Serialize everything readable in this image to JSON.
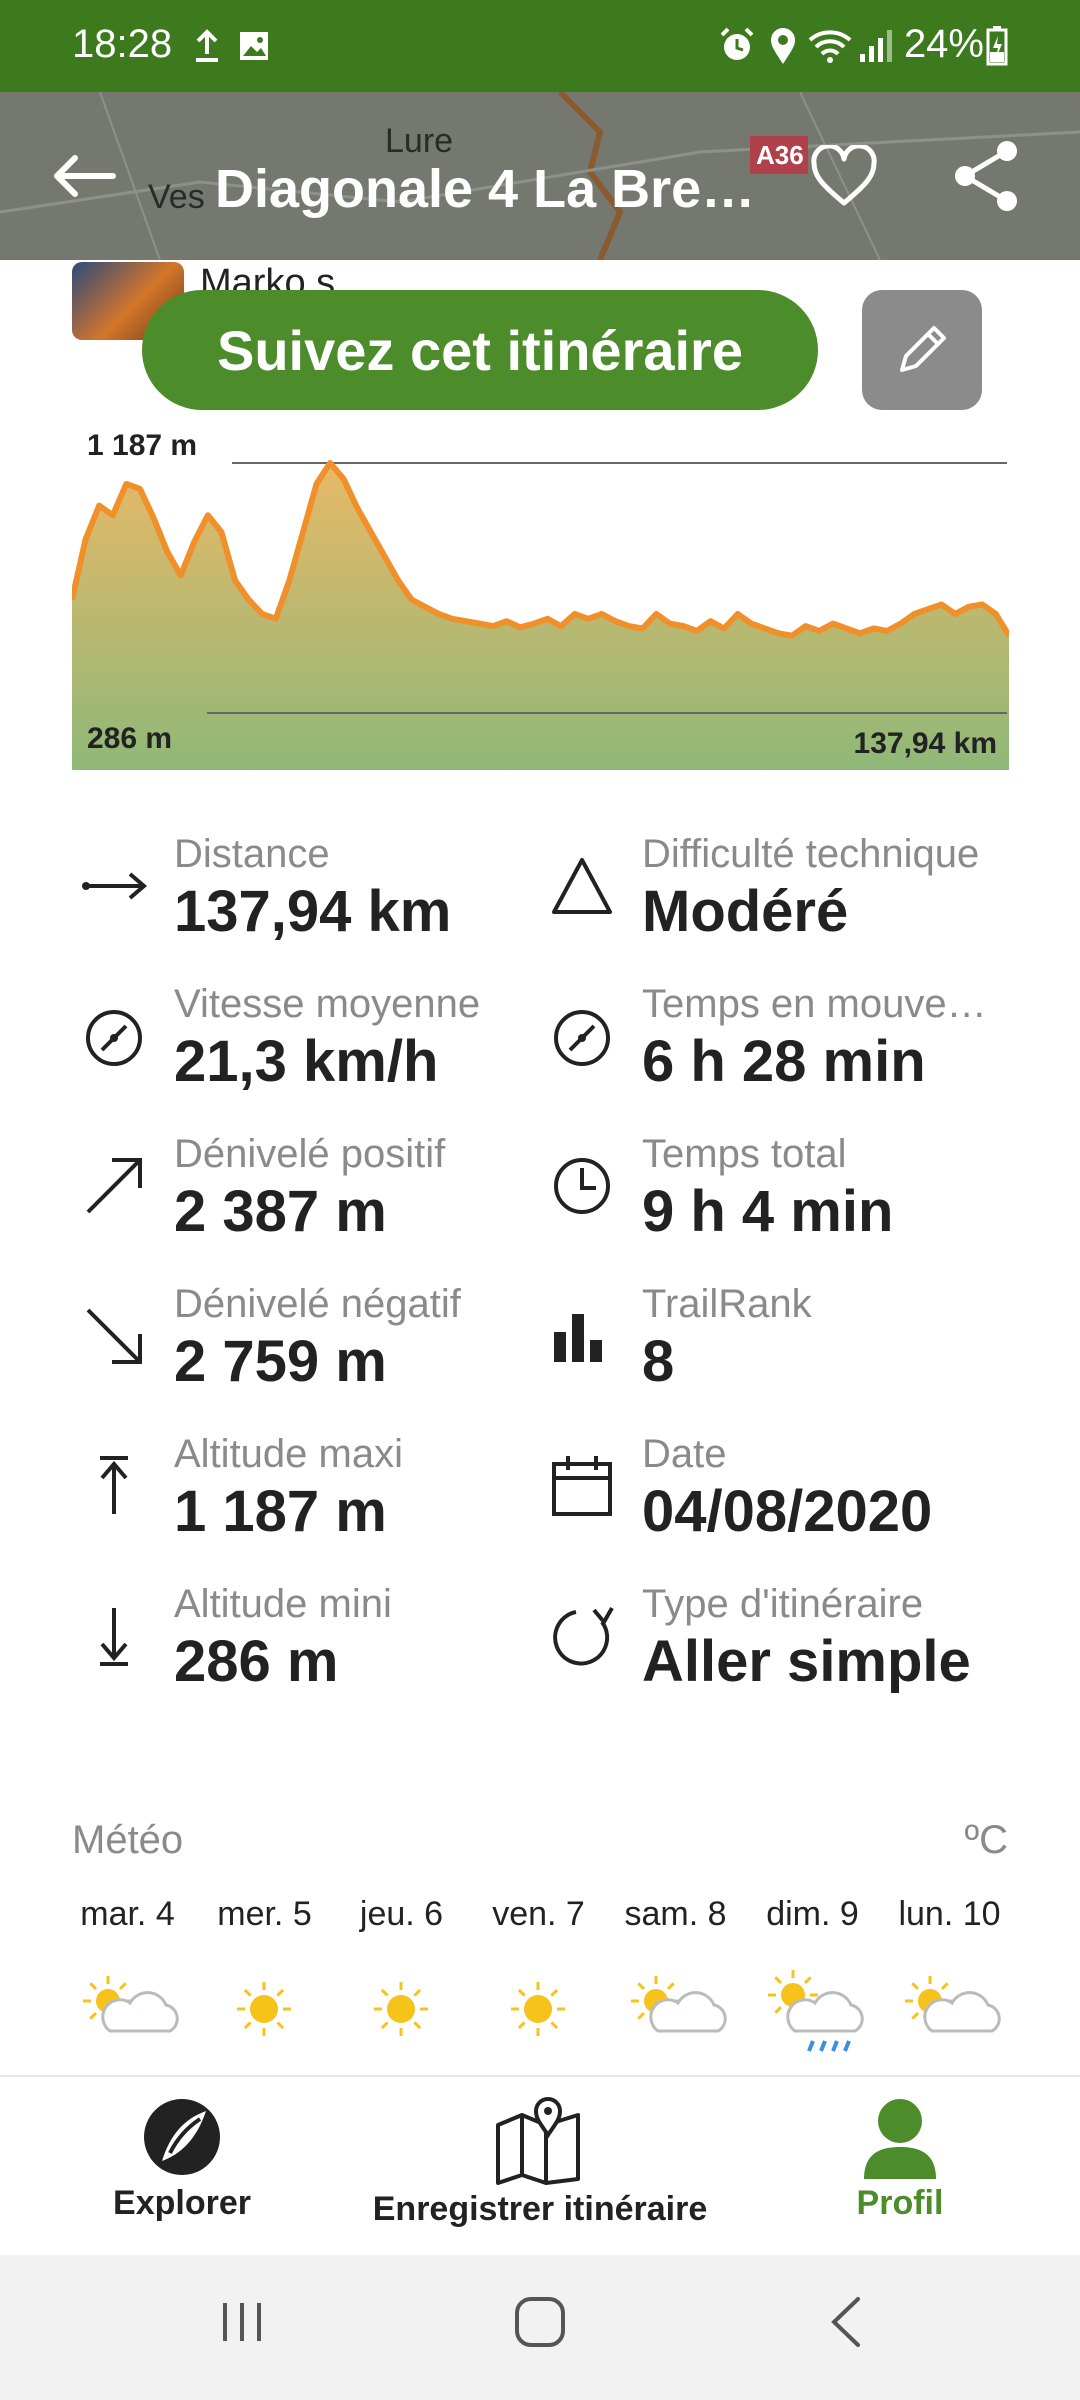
{
  "status_bar": {
    "time": "18:28",
    "battery": "24%"
  },
  "header": {
    "title": "Diagonale 4 La Bre…",
    "map_labels": [
      "Lure",
      "Ves",
      "A36"
    ]
  },
  "author": {
    "name": "Marko s"
  },
  "follow_button_label": "Suivez cet itinéraire",
  "chart_data": {
    "type": "area",
    "max_label": "1 187 m",
    "min_label": "286 m",
    "distance_label": "137,94 km",
    "x": [
      0,
      2,
      4,
      6,
      8,
      10,
      12,
      14,
      16,
      18,
      20,
      22,
      24,
      26,
      28,
      30,
      32,
      34,
      36,
      38,
      40,
      42,
      44,
      46,
      48,
      50,
      52,
      54,
      56,
      58,
      60,
      62,
      64,
      66,
      68,
      70,
      72,
      74,
      76,
      78,
      80,
      82,
      84,
      86,
      88,
      90,
      92,
      94,
      96,
      98,
      100,
      102,
      104,
      106,
      108,
      110,
      112,
      114,
      116,
      118,
      120,
      122,
      124,
      126,
      128,
      130,
      132,
      134,
      136,
      137.94
    ],
    "y": [
      620,
      870,
      1010,
      970,
      1100,
      1080,
      960,
      820,
      720,
      860,
      970,
      900,
      700,
      620,
      560,
      540,
      700,
      900,
      1100,
      1187,
      1120,
      1000,
      900,
      800,
      700,
      620,
      590,
      560,
      540,
      530,
      520,
      510,
      530,
      505,
      520,
      540,
      510,
      560,
      540,
      560,
      530,
      510,
      500,
      560,
      520,
      510,
      490,
      530,
      500,
      560,
      520,
      500,
      480,
      470,
      510,
      490,
      520,
      500,
      480,
      500,
      490,
      520,
      560,
      580,
      600,
      560,
      590,
      600,
      560,
      470
    ],
    "ylim": [
      286,
      1187
    ],
    "xlim": [
      0,
      137.94
    ]
  },
  "stats": [
    {
      "label": "Distance",
      "value": "137,94 km",
      "icon": "distance-arrow-icon"
    },
    {
      "label": "Difficulté technique",
      "value": "Modéré",
      "icon": "triangle-icon"
    },
    {
      "label": "Vitesse moyenne",
      "value": "21,3 km/h",
      "icon": "speedometer-icon"
    },
    {
      "label": "Temps en mouve…",
      "value": "6 h 28 min",
      "icon": "speedometer-icon"
    },
    {
      "label": "Dénivelé positif",
      "value": "2 387 m",
      "icon": "arrow-up-right-icon"
    },
    {
      "label": "Temps total",
      "value": "9 h 4 min",
      "icon": "clock-icon"
    },
    {
      "label": "Dénivelé négatif",
      "value": "2 759 m",
      "icon": "arrow-down-right-icon"
    },
    {
      "label": "TrailRank",
      "value": "8",
      "icon": "bar-chart-icon"
    },
    {
      "label": "Altitude maxi",
      "value": "1 187 m",
      "icon": "arrow-up-bar-icon"
    },
    {
      "label": "Date",
      "value": "04/08/2020",
      "icon": "calendar-icon"
    },
    {
      "label": "Altitude mini",
      "value": "286 m",
      "icon": "arrow-down-bar-icon"
    },
    {
      "label": "Type d'itinéraire",
      "value": "Aller simple",
      "icon": "loop-arrow-icon"
    }
  ],
  "weather": {
    "title": "Météo",
    "unit": "ºC",
    "days": [
      {
        "label": "mar. 4",
        "icon": "sun-cloud-icon"
      },
      {
        "label": "mer. 5",
        "icon": "sun-icon"
      },
      {
        "label": "jeu. 6",
        "icon": "sun-icon"
      },
      {
        "label": "ven. 7",
        "icon": "sun-icon"
      },
      {
        "label": "sam. 8",
        "icon": "sun-cloud-icon"
      },
      {
        "label": "dim. 9",
        "icon": "sun-rain-icon"
      },
      {
        "label": "lun. 10",
        "icon": "sun-cloud-icon"
      }
    ]
  },
  "bottom_nav": [
    {
      "label": "Explorer",
      "icon": "explorer-icon"
    },
    {
      "label": "Enregistrer itinéraire",
      "icon": "map-pin-icon"
    },
    {
      "label": "Profil",
      "icon": "person-icon",
      "active": true
    }
  ],
  "colors": {
    "brand_green": "#4c8c2b",
    "status_green": "#3d7a1e",
    "profile_orange": "#f0902a",
    "profile_fill_green": "#8fb878"
  }
}
